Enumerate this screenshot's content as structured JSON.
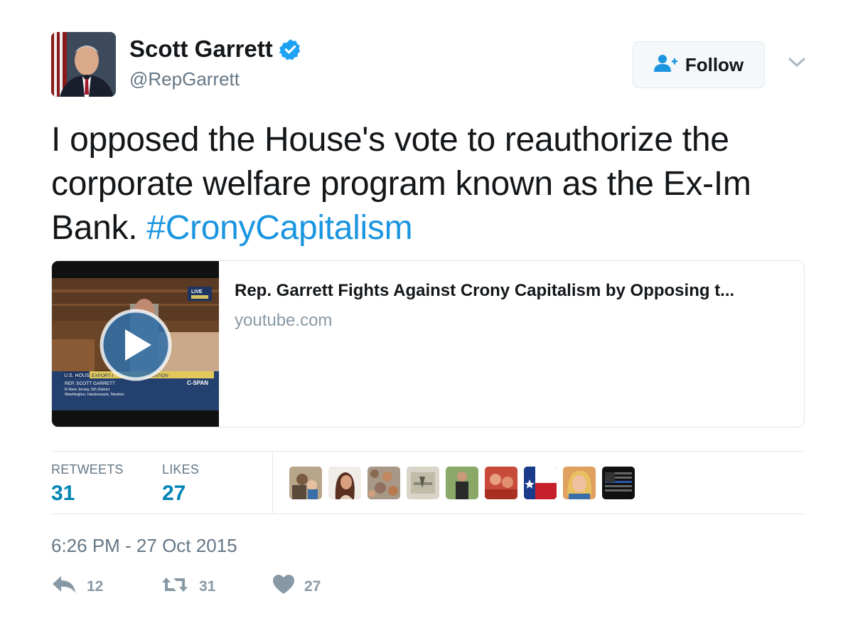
{
  "author": {
    "name": "Scott Garrett",
    "handle": "@RepGarrett",
    "verified": true
  },
  "follow_button": {
    "label": "Follow",
    "icon": "add-user-icon"
  },
  "tweet": {
    "text": "I opposed the House's vote to reauthorize the corporate welfare program known as the Ex-Im Bank.",
    "hashtag": "#CronyCapitalism"
  },
  "card": {
    "title": "Rep. Garrett Fights Against Crony Capitalism by Opposing t...",
    "domain": "youtube.com",
    "thumbnail_overlay": {
      "live": "LIVE",
      "lower_third_tag": "U.S. HOUSE",
      "lower_third_topic": "EXPORT-I",
      "lower_third_topic_end": "RIZATION",
      "speaker": "REP. SCOTT GARRETT",
      "district": "R-New Jersey, 5th District",
      "towns": "Washington, Hackensack, Newton",
      "network": "C-SPAN"
    }
  },
  "stats": {
    "retweets_label": "RETWEETS",
    "retweets": "31",
    "likes_label": "LIKES",
    "likes": "27"
  },
  "likers_count_shown": 9,
  "timestamp": "6:26 PM - 27 Oct 2015",
  "actions": {
    "reply_count": "12",
    "retweet_count": "31",
    "like_count": "27"
  },
  "colors": {
    "link": "#1b95e0",
    "stat_value": "#0084b4",
    "muted": "#657786",
    "icon": "#8899a6",
    "verified": "#1da1f2"
  }
}
